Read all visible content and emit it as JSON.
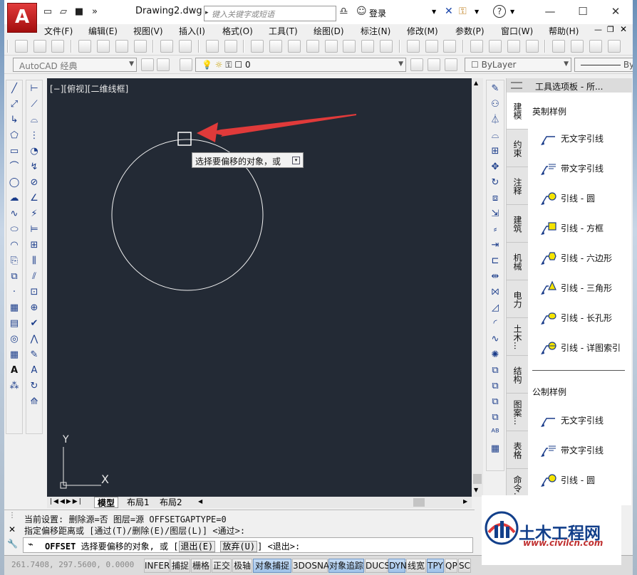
{
  "window": {
    "title": "Drawing2.dwg",
    "search_placeholder": "键入关键字或短语",
    "login": "登录"
  },
  "menus": [
    "文件(F)",
    "编辑(E)",
    "视图(V)",
    "插入(I)",
    "格式(O)",
    "工具(T)",
    "绘图(D)",
    "标注(N)",
    "修改(M)",
    "参数(P)",
    "窗口(W)",
    "帮助(H)"
  ],
  "toolbar": {
    "workspace": "AutoCAD 经典",
    "layer": "0",
    "color": "ByLayer",
    "linetype": "By"
  },
  "canvas": {
    "view_label": "[−][俯视][二维线框]",
    "tooltip": "选择要偏移的对象，或",
    "ucs_y": "Y",
    "ucs_x": "X"
  },
  "layout_tabs": [
    "模型",
    "布局1",
    "布局2"
  ],
  "palette": {
    "title": "工具选项板 - 所...",
    "tabs": [
      "建模",
      "约束",
      "注释",
      "建筑",
      "机械",
      "电力",
      "土木...",
      "结构",
      "图案...",
      "表格",
      "命令..."
    ],
    "section_imperial": "英制样例",
    "section_metric": "公制样例",
    "imperial_items": [
      "无文字引线",
      "带文字引线",
      "引线 - 圆",
      "引线 - 方框",
      "引线 - 六边形",
      "引线 - 三角形",
      "引线 - 长孔形",
      "引线 - 详图索引"
    ],
    "metric_items": [
      "无文字引线",
      "带文字引线",
      "引线 - 圆"
    ]
  },
  "command": {
    "line1": "当前设置: 删除源=否  图层=源  OFFSETGAPTYPE=0",
    "line2": "指定偏移距离或 [通过(T)/删除(E)/图层(L)] <通过>:",
    "prompt_cmd": "OFFSET",
    "prompt_text": "选择要偏移的对象, 或",
    "opt_exit": "退出(E)",
    "opt_undo": "放弃(U)",
    "prompt_default": "<退出>:"
  },
  "status": {
    "coords": "261.7408, 297.5600, 0.0000",
    "buttons": [
      "INFER",
      "捕捉",
      "栅格",
      "正交",
      "极轴",
      "对象捕捉",
      "3DOSNAP",
      "对象追踪",
      "DUCS",
      "DYN",
      "线宽",
      "TPY",
      "QP",
      "SC"
    ]
  },
  "watermark": {
    "title": "土木工程网",
    "url": "www.civilcn.com"
  },
  "colors": {
    "canvas_bg": "#232a35",
    "arrow_red": "#e03a3a",
    "app_red": "#c81e1e",
    "watermark_blue": "#123f8a"
  }
}
